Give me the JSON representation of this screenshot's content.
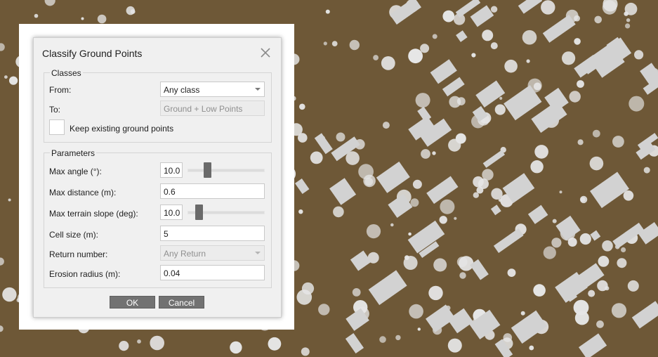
{
  "dialog": {
    "title": "Classify Ground Points",
    "classes": {
      "legend": "Classes",
      "from_label": "From:",
      "from_value": "Any class",
      "to_label": "To:",
      "to_value": "Ground + Low Points",
      "keep_label": "Keep existing ground points",
      "keep_checked": false
    },
    "parameters": {
      "legend": "Parameters",
      "max_angle_label": "Max angle (°):",
      "max_angle_value": "10.0",
      "max_angle_slider_fraction": 0.24,
      "max_distance_label": "Max distance (m):",
      "max_distance_value": "0.6",
      "max_slope_label": "Max terrain slope (deg):",
      "max_slope_value": "10.0",
      "max_slope_slider_fraction": 0.11,
      "cell_size_label": "Cell size (m):",
      "cell_size_value": "5",
      "return_label": "Return number:",
      "return_value": "Any Return",
      "erosion_label": "Erosion radius (m):",
      "erosion_value": "0.04"
    },
    "buttons": {
      "ok": "OK",
      "cancel": "Cancel"
    }
  },
  "colors": {
    "terrain": "#6e5837",
    "points": "#e6e6e6",
    "dialog_bg": "#f0f0f0",
    "button_bg": "#727272"
  },
  "icons": {
    "close": "close-icon",
    "dropdown": "chevron-down-icon"
  }
}
